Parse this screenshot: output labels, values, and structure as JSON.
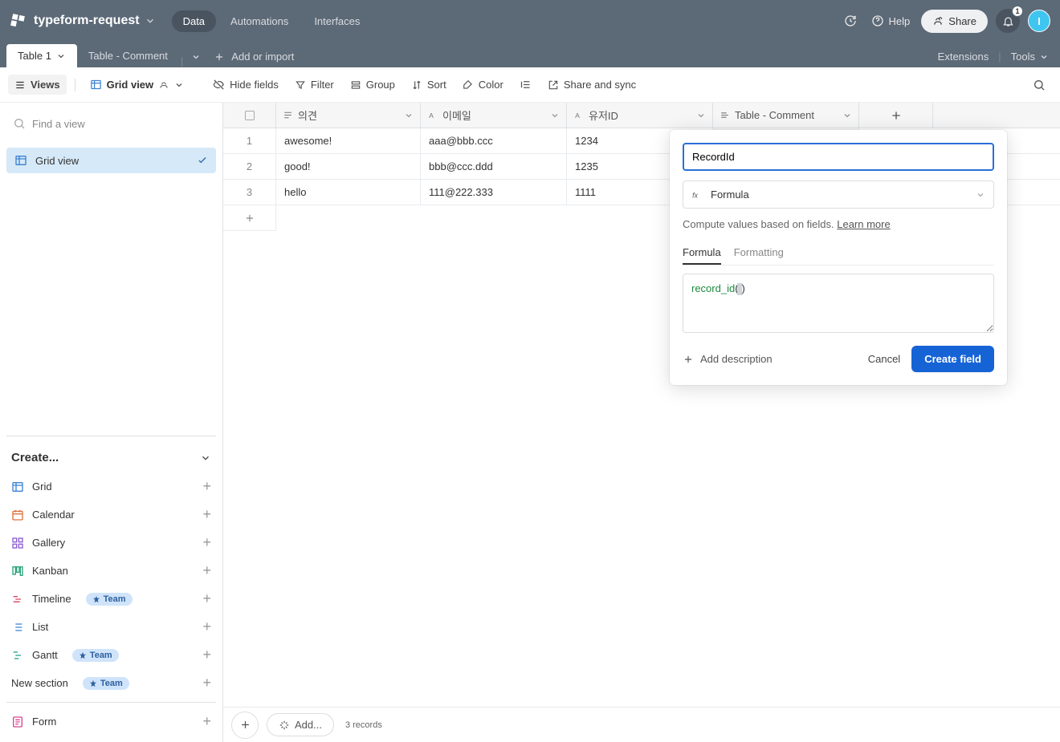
{
  "header": {
    "base_name": "typeform-request",
    "nav": {
      "data": "Data",
      "automations": "Automations",
      "interfaces": "Interfaces"
    },
    "help": "Help",
    "share": "Share",
    "bell_count": "1",
    "avatar": "I"
  },
  "table_tabs": {
    "tab1": "Table 1",
    "tab2": "Table - Comment",
    "add_import": "Add or import",
    "extensions": "Extensions",
    "tools": "Tools"
  },
  "toolbar": {
    "views": "Views",
    "grid_view": "Grid view",
    "hide_fields": "Hide fields",
    "filter": "Filter",
    "group": "Group",
    "sort": "Sort",
    "color": "Color",
    "share_sync": "Share and sync"
  },
  "sidebar": {
    "find_placeholder": "Find a view",
    "active_view": "Grid view",
    "create_header": "Create...",
    "create_items": {
      "grid": "Grid",
      "calendar": "Calendar",
      "gallery": "Gallery",
      "kanban": "Kanban",
      "timeline": "Timeline",
      "list": "List",
      "gantt": "Gantt",
      "new_section": "New section",
      "form": "Form"
    },
    "team_badge": "Team"
  },
  "columns": {
    "c1": "의견",
    "c2": "이메일",
    "c3": "유저ID",
    "c4": "Table - Comment"
  },
  "rows": [
    {
      "n": "1",
      "a": "awesome!",
      "b": "aaa@bbb.ccc",
      "c": "1234"
    },
    {
      "n": "2",
      "a": "good!",
      "b": "bbb@ccc.ddd",
      "c": "1235"
    },
    {
      "n": "3",
      "a": "hello",
      "b": "111@222.333",
      "c": "1111"
    }
  ],
  "footer": {
    "add_label": "Add...",
    "record_count": "3 records"
  },
  "popover": {
    "name_value": "RecordId",
    "type_label": "Formula",
    "help_text": "Compute values based on fields. ",
    "learn_more": "Learn more",
    "tab_formula": "Formula",
    "tab_formatting": "Formatting",
    "formula_fn": "record_id",
    "add_description": "Add description",
    "cancel": "Cancel",
    "create": "Create field"
  }
}
